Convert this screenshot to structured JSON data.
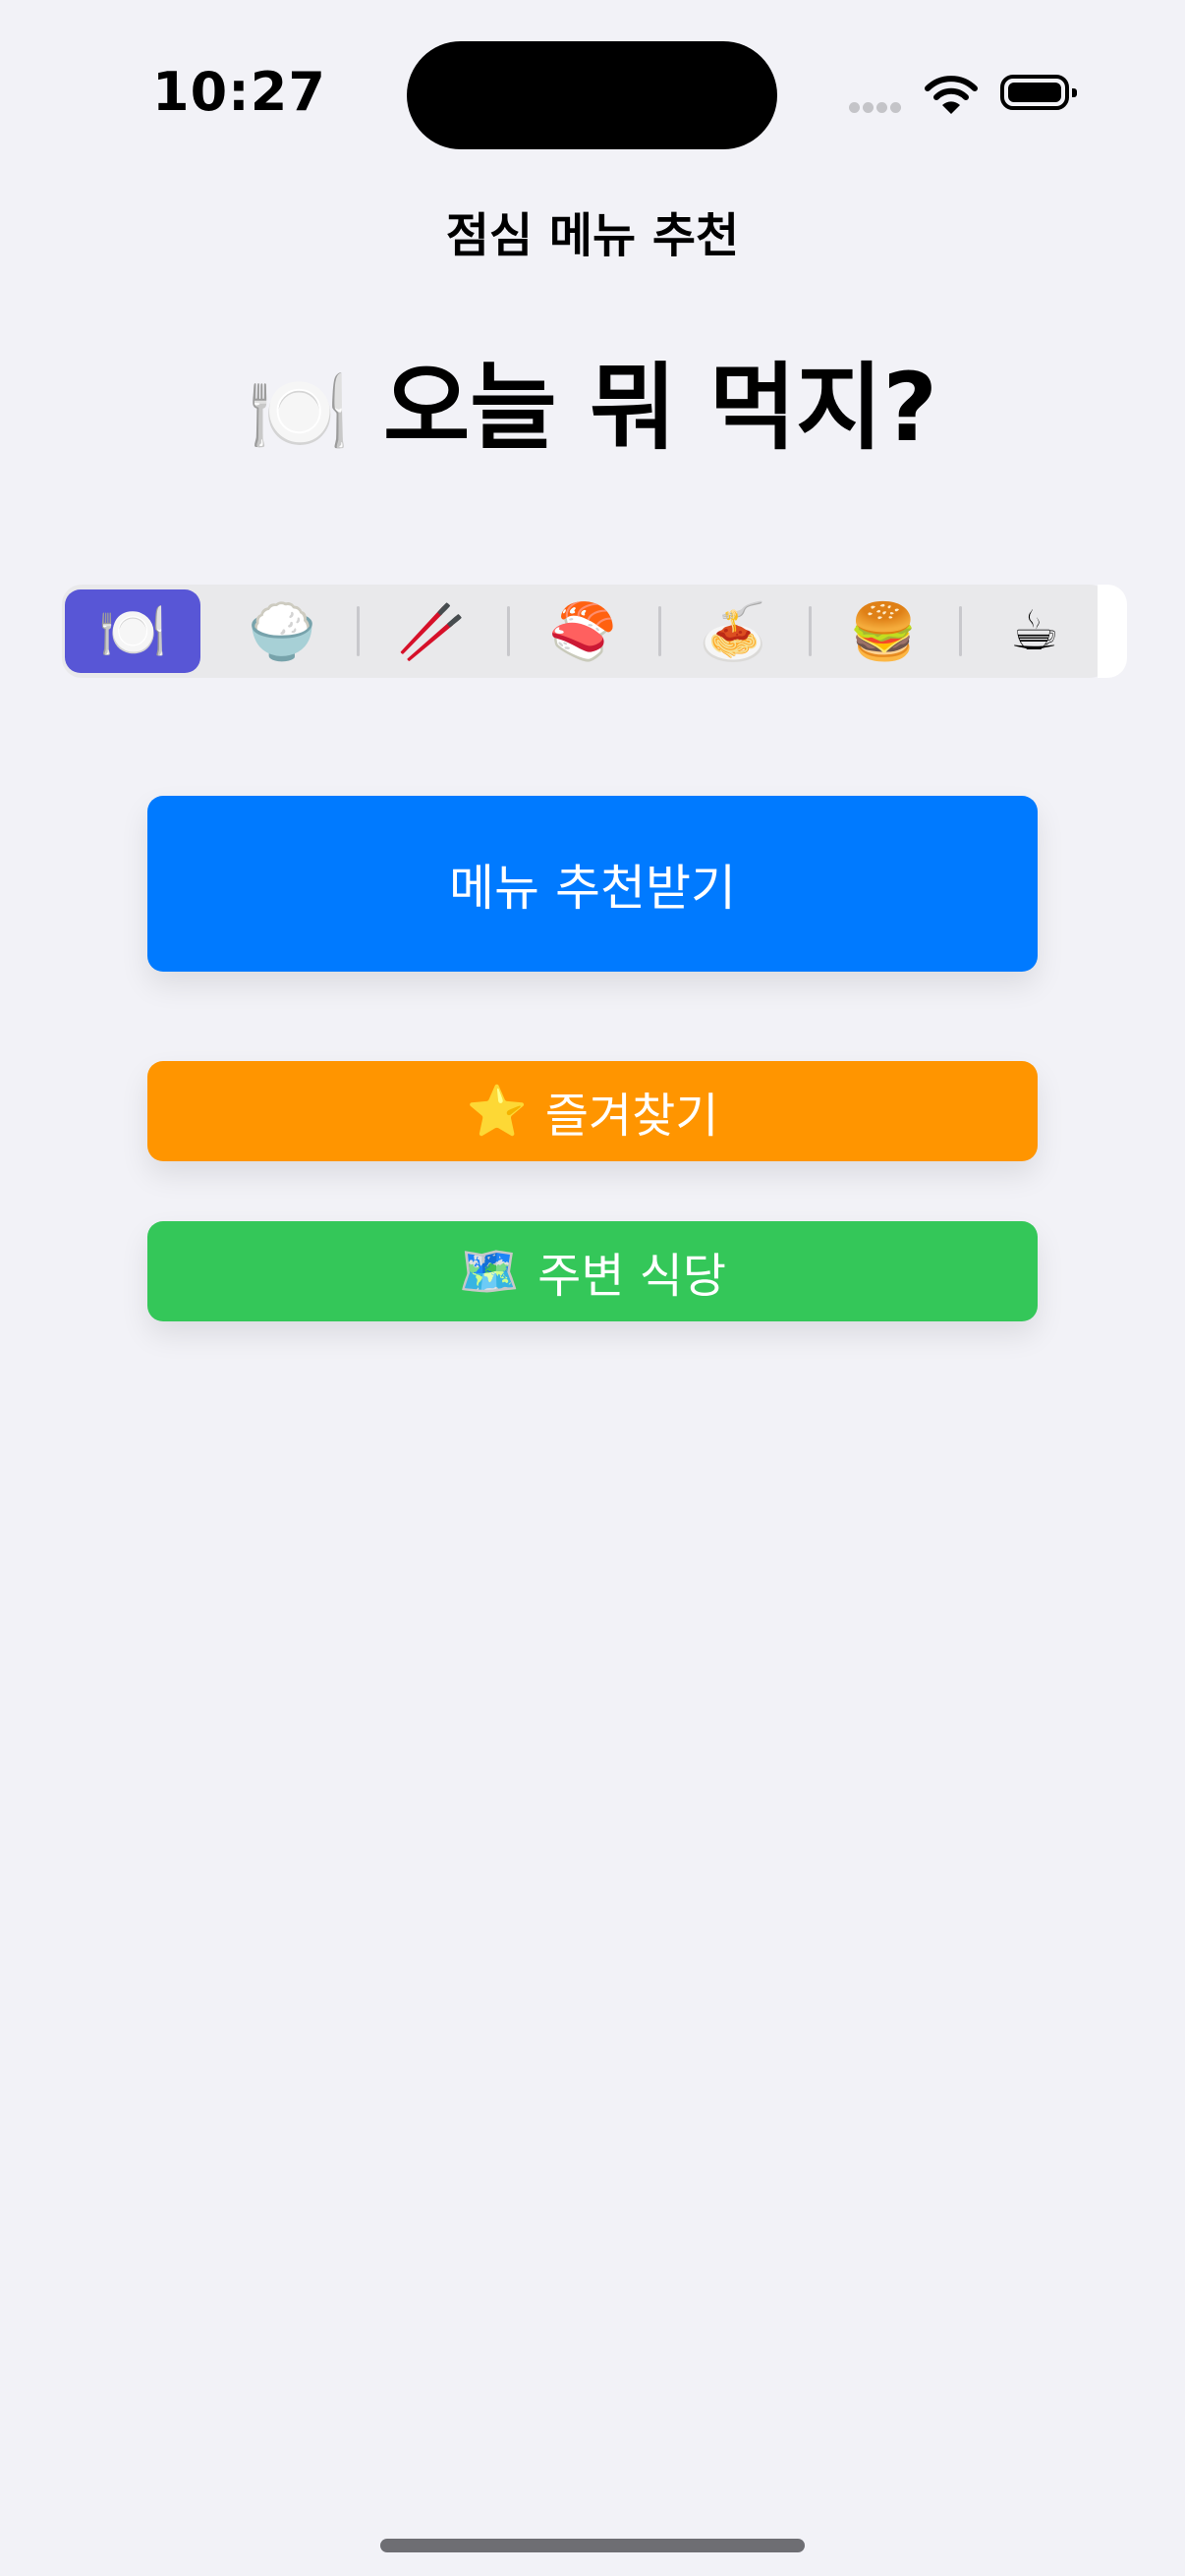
{
  "status_bar": {
    "time": "10:27",
    "icons": [
      "cellular-signal-icon",
      "wifi-icon",
      "battery-icon"
    ]
  },
  "nav": {
    "title": "점심 메뉴 추천"
  },
  "headline": {
    "emoji": "🍽️",
    "text": "오늘 뭐 먹지?"
  },
  "categories": {
    "selected_index": 0,
    "items": [
      {
        "emoji": "🍽️",
        "name": "plate-icon"
      },
      {
        "emoji": "🍚",
        "name": "rice-icon"
      },
      {
        "emoji": "🥢",
        "name": "chopsticks-icon"
      },
      {
        "emoji": "🍣",
        "name": "sushi-icon"
      },
      {
        "emoji": "🍝",
        "name": "spaghetti-icon"
      },
      {
        "emoji": "🍔",
        "name": "hamburger-icon"
      },
      {
        "emoji": "☕",
        "name": "coffee-icon"
      }
    ]
  },
  "buttons": {
    "recommend": {
      "label": "메뉴 추천받기",
      "color": "#007aff"
    },
    "favorites": {
      "icon": "⭐",
      "label": "즐겨찾기",
      "color": "#ff9500"
    },
    "nearby": {
      "icon": "🗺️",
      "label": "주변 식당",
      "color": "#34c759"
    }
  },
  "colors": {
    "background": "#f2f2f7",
    "segment_selected": "#5856d6"
  }
}
